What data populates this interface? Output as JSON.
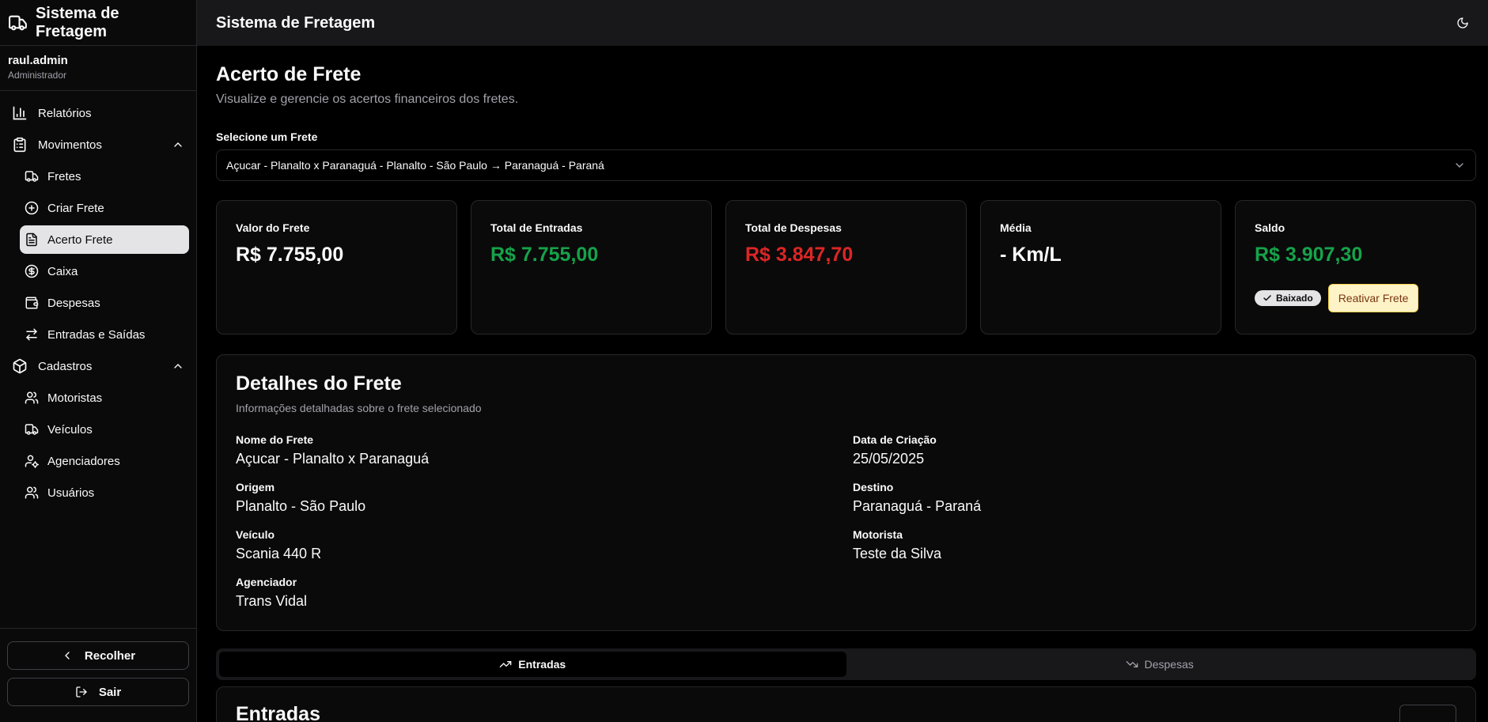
{
  "sidebar": {
    "brand": "Sistema de Fretagem",
    "user": {
      "name": "raul.admin",
      "role": "Administrador"
    },
    "items": {
      "relatorios": "Relatórios",
      "movimentos": "Movimentos",
      "fretes": "Fretes",
      "criar_frete": "Criar Frete",
      "acerto_frete": "Acerto Frete",
      "caixa": "Caixa",
      "despesas": "Despesas",
      "entradas_saidas": "Entradas e Saídas",
      "cadastros": "Cadastros",
      "motoristas": "Motoristas",
      "veiculos": "Veículos",
      "agenciadores": "Agenciadores",
      "usuarios": "Usuários"
    },
    "footer": {
      "collapse": "Recolher",
      "logout": "Sair"
    }
  },
  "topbar": {
    "title": "Sistema de Fretagem"
  },
  "page": {
    "title": "Acerto de Frete",
    "subtitle": "Visualize e gerencie os acertos financeiros dos fretes.",
    "select_label": "Selecione um Frete",
    "select_value": "Açucar - Planalto x Paranaguá - Planalto - São Paulo → Paranaguá - Paraná"
  },
  "stats": {
    "valor_label": "Valor do Frete",
    "valor": "R$ 7.755,00",
    "entradas_label": "Total de Entradas",
    "entradas": "R$ 7.755,00",
    "despesas_label": "Total de Despesas",
    "despesas": "R$ 3.847,70",
    "media_label": "Média",
    "media": "- Km/L",
    "saldo_label": "Saldo",
    "saldo": "R$ 3.907,30",
    "badge": "Baixado",
    "reactivate": "Reativar Frete"
  },
  "details": {
    "title": "Detalhes do Frete",
    "subtitle": "Informações detalhadas sobre o frete selecionado",
    "nome_label": "Nome do Frete",
    "nome": "Açucar - Planalto x Paranaguá",
    "data_label": "Data de Criação",
    "data": "25/05/2025",
    "origem_label": "Origem",
    "origem": "Planalto - São Paulo",
    "destino_label": "Destino",
    "destino": "Paranaguá - Paraná",
    "veiculo_label": "Veículo",
    "veiculo": "Scania 440 R",
    "motorista_label": "Motorista",
    "motorista": "Teste da Silva",
    "agenciador_label": "Agenciador",
    "agenciador": "Trans Vidal"
  },
  "tabs": {
    "entradas": "Entradas",
    "despesas": "Despesas"
  },
  "panel": {
    "title": "Entradas"
  },
  "colors": {
    "green": "#16a34a",
    "red": "#dc2626",
    "warn_bg": "#fef3c7"
  }
}
